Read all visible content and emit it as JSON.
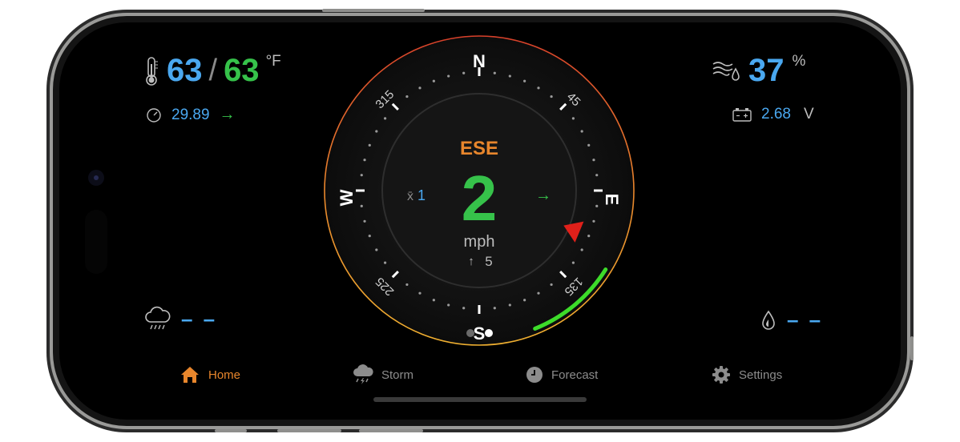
{
  "temperature": {
    "high": "63",
    "separator": "/",
    "low": "63",
    "unit": "°F"
  },
  "pressure": {
    "value": "29.89",
    "trend": "→"
  },
  "humidity": {
    "value": "37",
    "unit": "%"
  },
  "battery": {
    "value": "2.68",
    "unit": "V"
  },
  "rain": {
    "value": "– –"
  },
  "dew": {
    "value": "– –"
  },
  "compass": {
    "direction": "ESE",
    "speed": "2",
    "speed_unit": "mph",
    "average_label": "x̄",
    "average_value": "1",
    "gust_arrow": "↑",
    "gust_value": "5",
    "trend": "→",
    "cardinals": {
      "n": "N",
      "e": "E",
      "s": "S",
      "w": "W"
    },
    "degree_labels": {
      "ne": "45",
      "se": "135",
      "sw": "225",
      "nw": "315"
    },
    "wind_direction_deg": 112.5,
    "gust_arc_from_deg": 122,
    "gust_arc_to_deg": 158,
    "colors": {
      "direction": "#e8862c",
      "speed": "#36c24a",
      "pointer": "#e0201a",
      "gust_arc": "#3ddc2a"
    }
  },
  "tabs": [
    {
      "label": "Home",
      "icon": "home-icon",
      "active": true
    },
    {
      "label": "Storm",
      "icon": "storm-icon",
      "active": false
    },
    {
      "label": "Forecast",
      "icon": "clock-icon",
      "active": false
    },
    {
      "label": "Settings",
      "icon": "gear-icon",
      "active": false
    }
  ],
  "colors": {
    "accent": "#e8862c",
    "value_blue": "#4aa8f0",
    "value_green": "#36c24a"
  }
}
